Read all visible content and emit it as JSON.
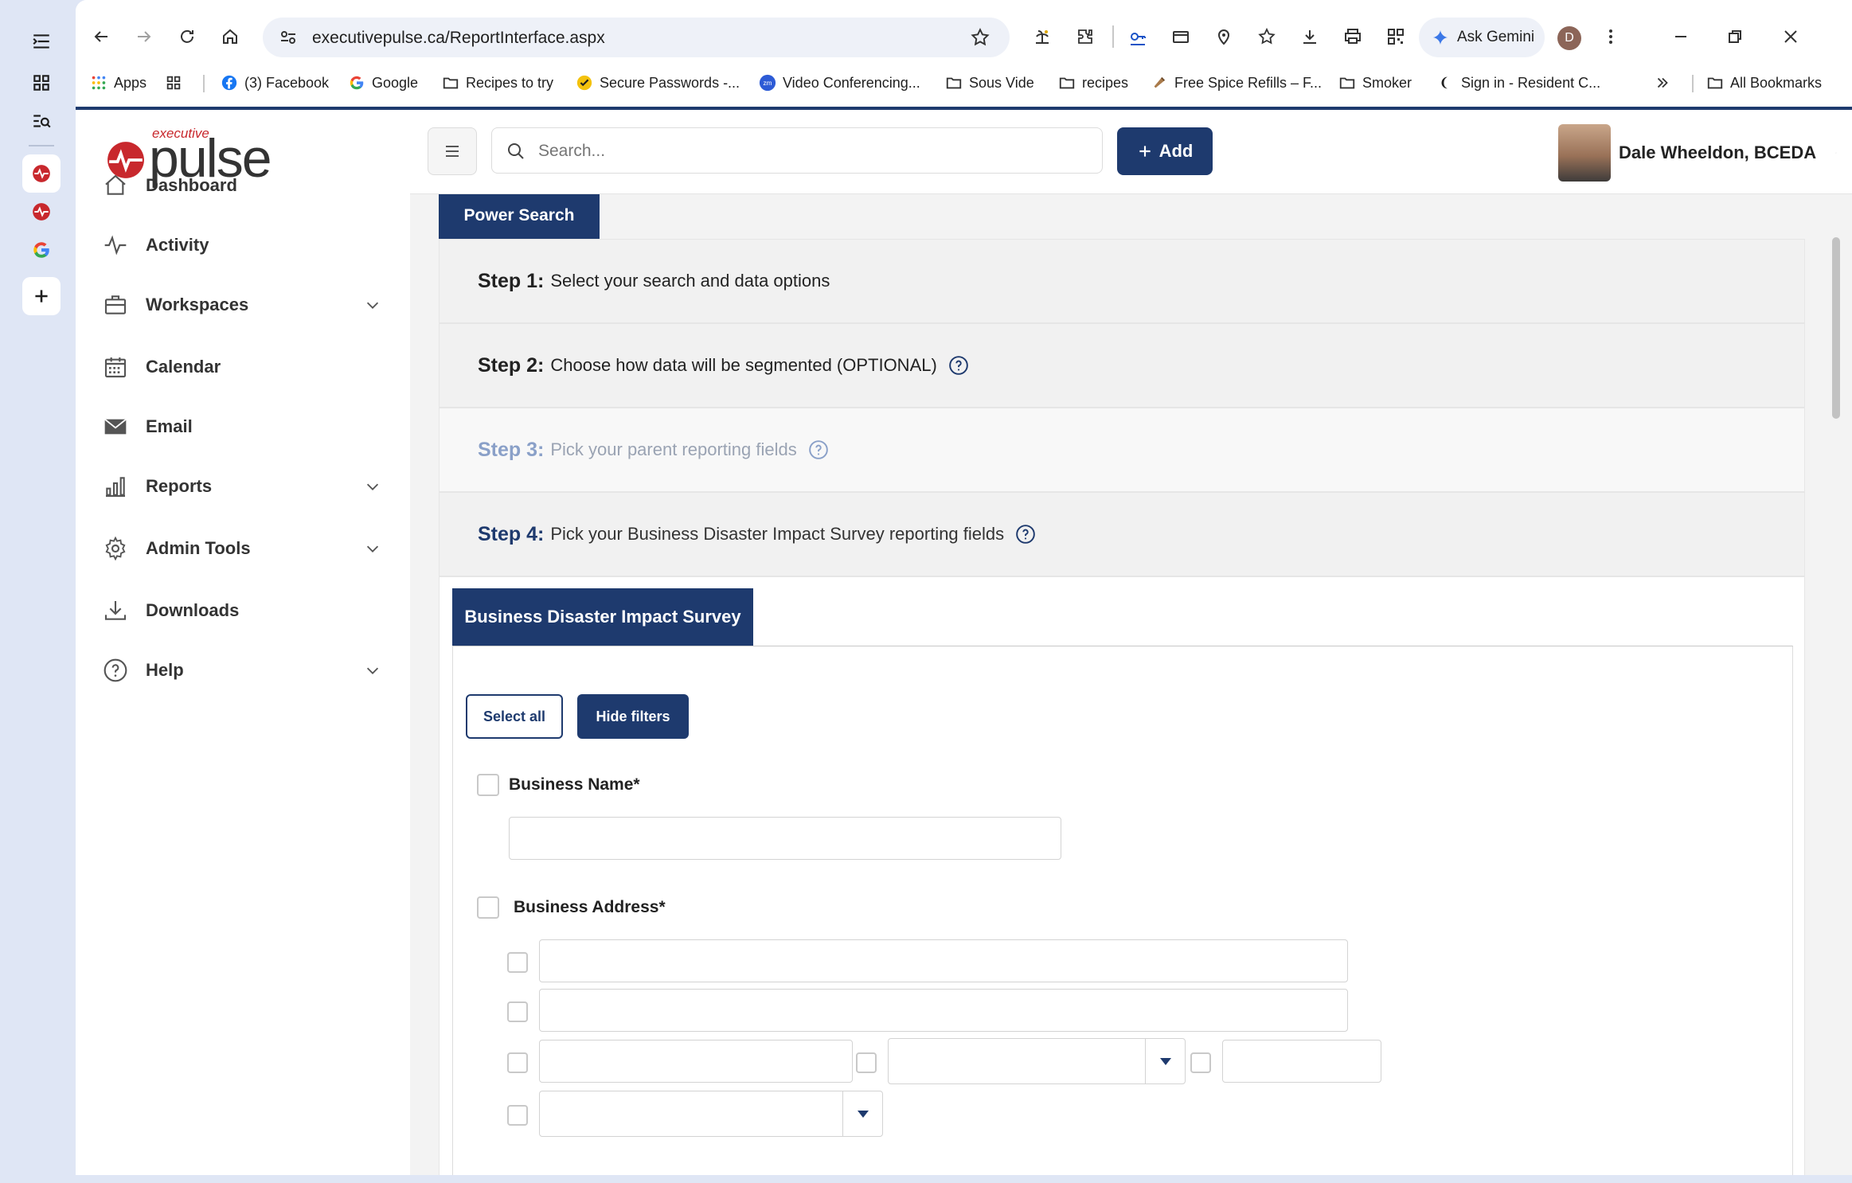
{
  "browser": {
    "url": "executivepulse.ca/ReportInterface.aspx",
    "gemini_label": "Ask Gemini",
    "profile_initial": "D",
    "bookmarks": [
      {
        "label": "Apps",
        "icon": "apps-grid-icon"
      },
      {
        "label": "",
        "icon": "grid-icon"
      },
      {
        "label": "(3) Facebook",
        "icon": "facebook-icon"
      },
      {
        "label": "Google",
        "icon": "google-icon"
      },
      {
        "label": "Recipes to try",
        "icon": "folder-icon"
      },
      {
        "label": "Secure Passwords -...",
        "icon": "check-icon"
      },
      {
        "label": "Video Conferencing...",
        "icon": "zoom-icon"
      },
      {
        "label": "Sous Vide",
        "icon": "folder-icon"
      },
      {
        "label": "recipes",
        "icon": "folder-icon"
      },
      {
        "label": "Free Spice Refills – F...",
        "icon": "spice-icon"
      },
      {
        "label": "Smoker",
        "icon": "folder-icon"
      },
      {
        "label": "Sign in - Resident C...",
        "icon": "moon-icon"
      }
    ],
    "all_bookmarks": "All Bookmarks"
  },
  "app": {
    "logo_small": "executive",
    "logo_big": "pulse",
    "nav": [
      {
        "label": "Dashboard",
        "icon": "home-icon",
        "expandable": false
      },
      {
        "label": "Activity",
        "icon": "activity-icon",
        "expandable": false
      },
      {
        "label": "Workspaces",
        "icon": "briefcase-icon",
        "expandable": true
      },
      {
        "label": "Calendar",
        "icon": "calendar-icon",
        "expandable": false
      },
      {
        "label": "Email",
        "icon": "envelope-icon",
        "expandable": false
      },
      {
        "label": "Reports",
        "icon": "bar-chart-icon",
        "expandable": true
      },
      {
        "label": "Admin Tools",
        "icon": "gear-icon",
        "expandable": true
      },
      {
        "label": "Downloads",
        "icon": "download-icon",
        "expandable": false
      },
      {
        "label": "Help",
        "icon": "question-icon",
        "expandable": true
      }
    ],
    "search_placeholder": "Search...",
    "add_label": "Add",
    "user_name": "Dale Wheeldon, BCEDA"
  },
  "content": {
    "power_search_tab": "Power Search",
    "steps": [
      {
        "num": "Step 1:",
        "text": "Select your search and data options",
        "help": false
      },
      {
        "num": "Step 2:",
        "text": "Choose how data will be segmented (OPTIONAL)",
        "help": true
      },
      {
        "num": "Step 3:",
        "text": "Pick your parent reporting fields",
        "help": true
      },
      {
        "num": "Step 4:",
        "text": "Pick your Business Disaster Impact Survey reporting fields",
        "help": true
      }
    ],
    "survey_tab": "Business Disaster Impact Survey",
    "select_all": "Select all",
    "hide_filters": "Hide filters",
    "field_business_name": "Business Name*",
    "field_business_address": "Business Address*"
  },
  "colors": {
    "brand_navy": "#1e3a6e",
    "brand_red": "#c8282d"
  }
}
